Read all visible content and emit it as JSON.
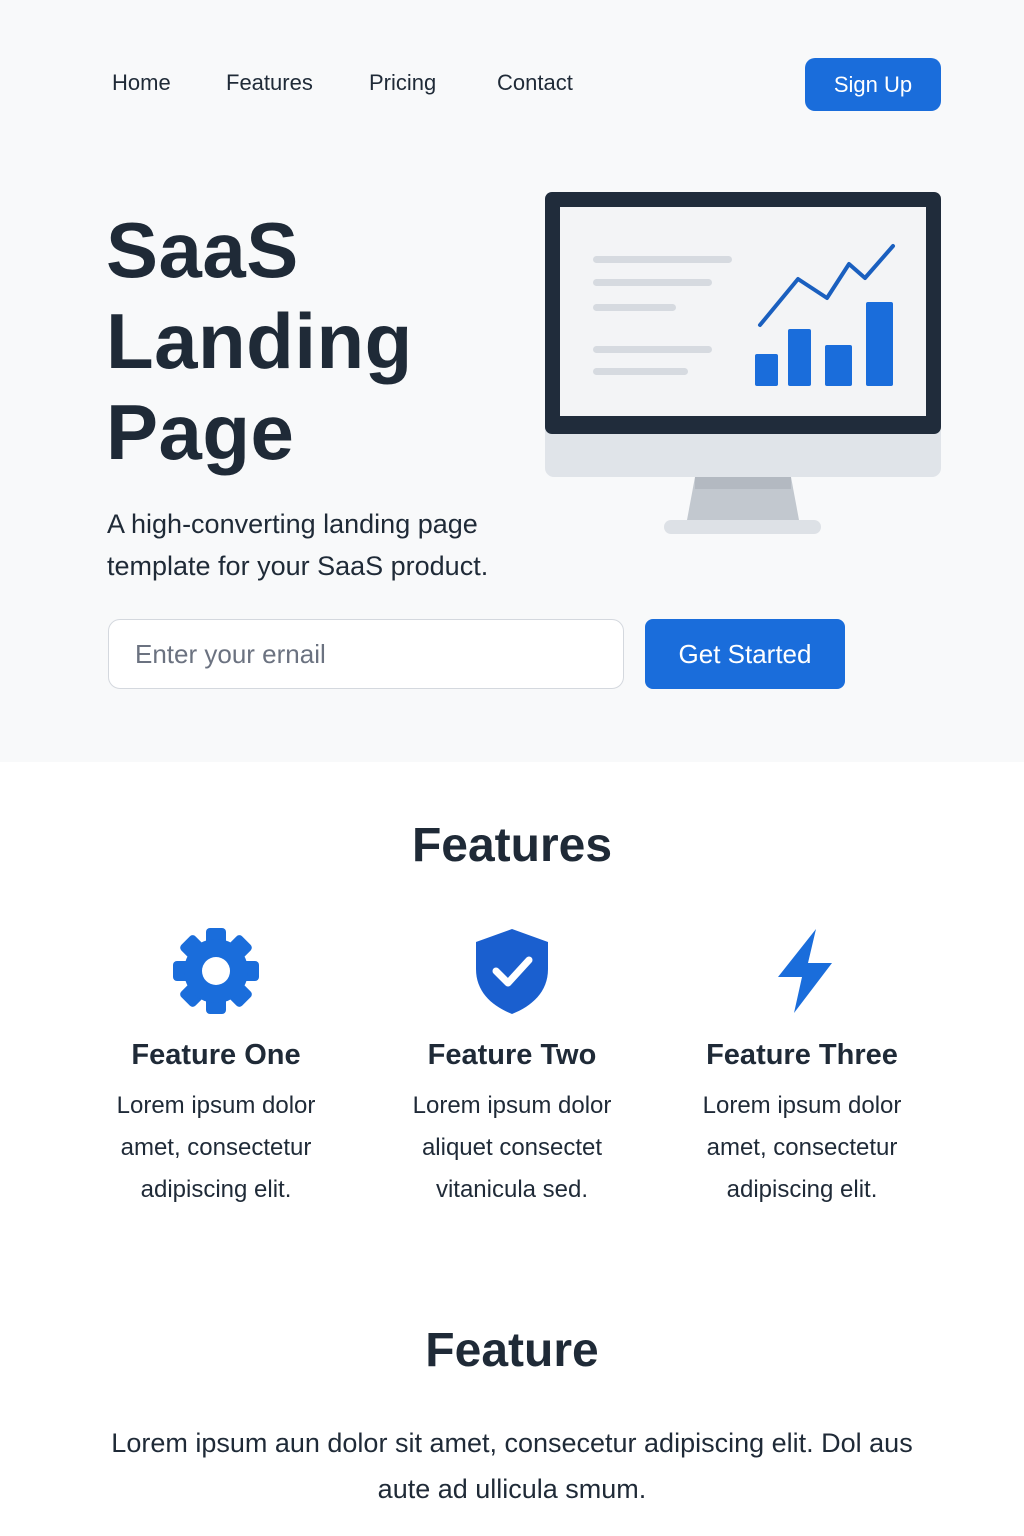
{
  "nav": {
    "links": [
      "Home",
      "Features",
      "Pricing",
      "Contact"
    ],
    "signup_label": "Sign Up"
  },
  "hero": {
    "title_lines": [
      "SaaS",
      "Landing",
      "Page"
    ],
    "subtitle": "A high-converting landing page template for your SaaS product.",
    "email_placeholder": "Enter your ernail",
    "cta_label": "Get Started",
    "illustration_icon": "monitor-chart-icon"
  },
  "features": {
    "heading": "Features",
    "items": [
      {
        "icon": "gear-icon",
        "title": "Feature One",
        "description": "Lorem ipsum dolor amet, consectetur adipiscing elit."
      },
      {
        "icon": "shield-check-icon",
        "title": "Feature Two",
        "description": "Lorem ipsum dolor aliquet consectet vitanicula sed."
      },
      {
        "icon": "lightning-icon",
        "title": "Feature Three",
        "description": "Lorem ipsum dolor amet, consectetur adipiscing elit."
      }
    ]
  },
  "feature_section": {
    "heading": "Feature",
    "text": "Lorem ipsum aun dolor sit amet, consecetur adipiscing elit. Dol aus aute ad ullicula smum."
  },
  "colors": {
    "accent": "#1a6ddb",
    "text": "#1f2a37",
    "hero_background": "#f8f9fa"
  }
}
